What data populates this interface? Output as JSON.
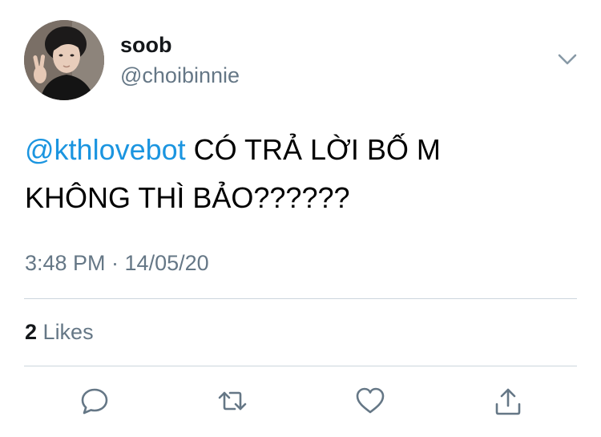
{
  "user": {
    "display_name": "soob",
    "handle": "@choibinnie",
    "avatar_icon": "profile-photo"
  },
  "tweet": {
    "mention": "@kthlovebot",
    "text_line1": " CÓ TRẢ LỜI BỐ M",
    "text_line2": "KHÔNG THÌ BẢO??????",
    "timestamp": "3:48 PM · 14/05/20"
  },
  "stats": {
    "likes_count": "2",
    "likes_label": "Likes"
  },
  "actions": {
    "reply_icon": "reply-icon",
    "retweet_icon": "retweet-icon",
    "like_icon": "heart-icon",
    "share_icon": "share-icon"
  },
  "colors": {
    "mention": "#1b95e0",
    "secondary_text": "#657786",
    "icon": "#657786",
    "divider": "#ccd6dd"
  }
}
